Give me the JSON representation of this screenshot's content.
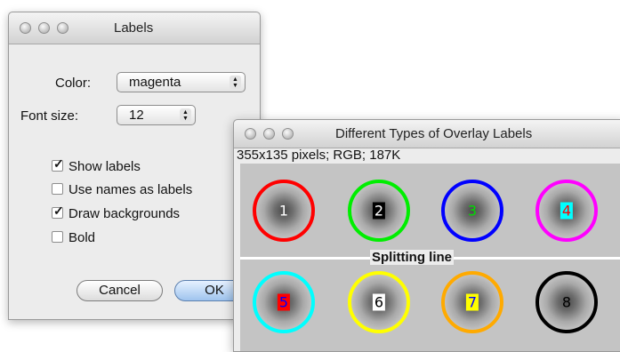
{
  "labels_dialog": {
    "title": "Labels",
    "color_label": "Color:",
    "color_value": "magenta",
    "font_size_label": "Font size:",
    "font_size_value": "12",
    "checkboxes": [
      {
        "label": "Show labels",
        "checked": true
      },
      {
        "label": "Use names as labels",
        "checked": false
      },
      {
        "label": "Draw backgrounds",
        "checked": true
      },
      {
        "label": "Bold",
        "checked": false
      }
    ],
    "cancel_label": "Cancel",
    "ok_label": "OK"
  },
  "overlay_window": {
    "title": "Different Types of Overlay Labels",
    "info": "355x135 pixels; RGB; 187K",
    "splitting_label": "Splitting line",
    "circles": [
      {
        "label": "1",
        "ring_color": "#ff0000",
        "text_color": "#ffffff",
        "bg": "transparent"
      },
      {
        "label": "2",
        "ring_color": "#00ee00",
        "text_color": "#ffffff",
        "bg": "#000000"
      },
      {
        "label": "3",
        "ring_color": "#0000ff",
        "text_color": "#00dd00",
        "bg": "transparent"
      },
      {
        "label": "4",
        "ring_color": "#ff00ff",
        "text_color": "#ff0000",
        "bg": "#00ffff"
      },
      {
        "label": "5",
        "ring_color": "#00ffff",
        "text_color": "#0000ff",
        "bg": "#ff0000"
      },
      {
        "label": "6",
        "ring_color": "#ffff00",
        "text_color": "#000000",
        "bg": "#ffffff"
      },
      {
        "label": "7",
        "ring_color": "#ffaa00",
        "text_color": "#0000ff",
        "bg": "#ffff00"
      },
      {
        "label": "8",
        "ring_color": "#000000",
        "text_color": "#000000",
        "bg": "transparent"
      }
    ]
  }
}
